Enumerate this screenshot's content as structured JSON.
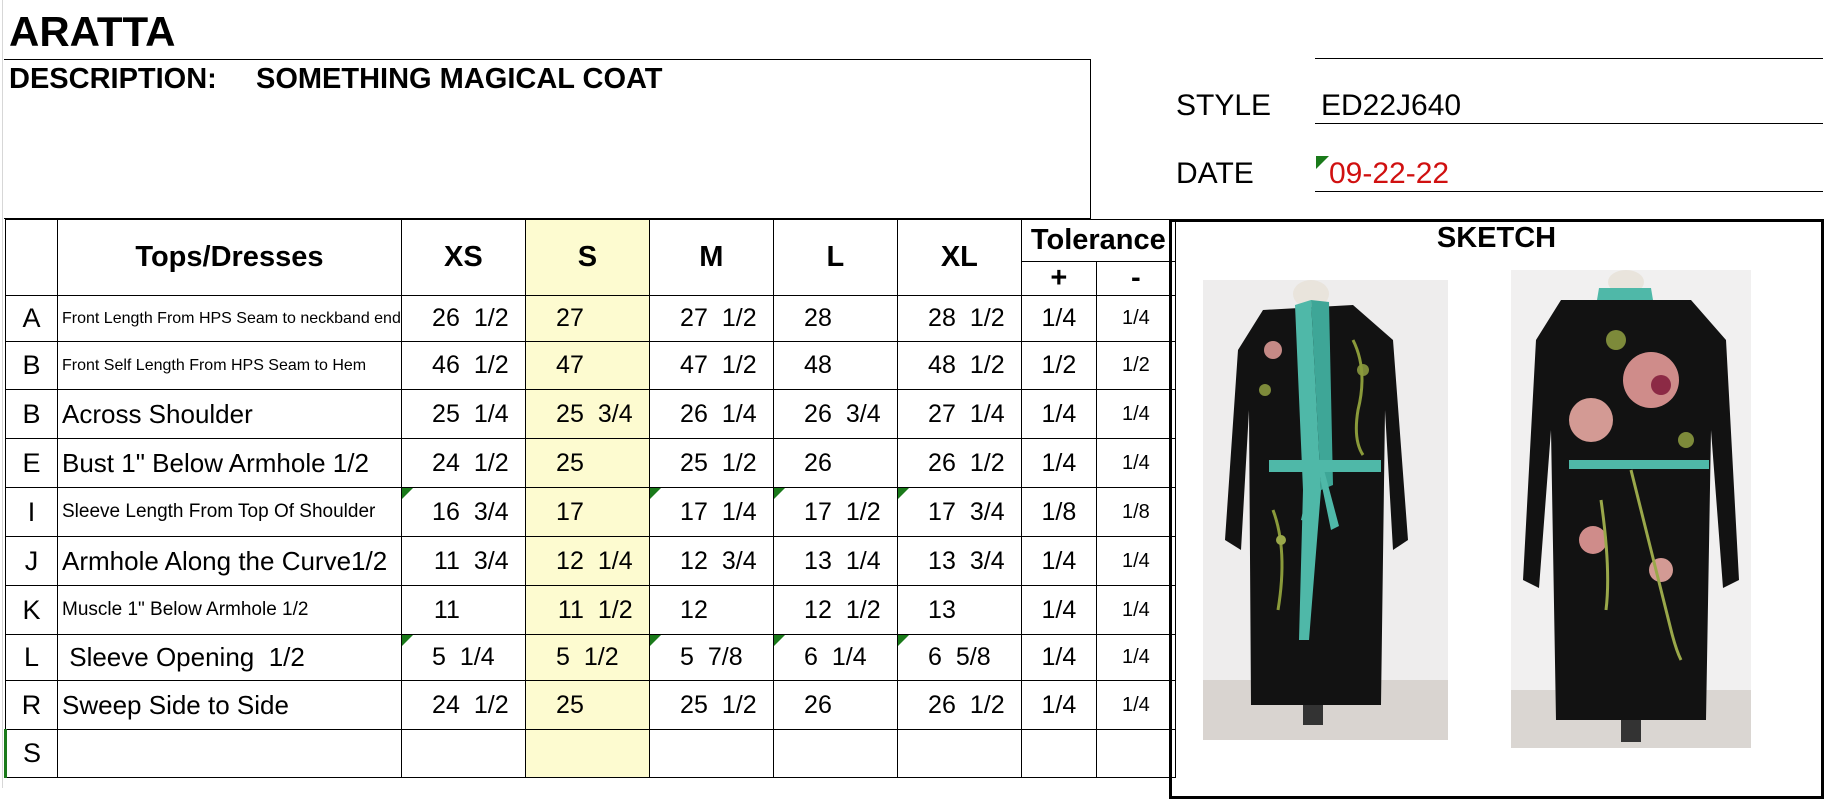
{
  "brand": "ARATTA",
  "description": {
    "label": "DESCRIPTION:",
    "value": "SOMETHING MAGICAL COAT"
  },
  "style": {
    "label": "STYLE",
    "value": "ED22J640"
  },
  "date": {
    "label": "DATE",
    "value": "09-22-22"
  },
  "table": {
    "header": {
      "item": "Tops/Dresses",
      "sizes": [
        "XS",
        "S",
        "M",
        "L",
        "XL"
      ],
      "tolerance": "Tolerance",
      "plus": "+",
      "minus": "-"
    },
    "rows": [
      {
        "letter": "A",
        "desc": "Front Length From HPS Seam to neckband end",
        "vals": [
          [
            "26",
            "1/2"
          ],
          [
            "27",
            ""
          ],
          [
            "27",
            "1/2"
          ],
          [
            "28",
            ""
          ],
          [
            "28",
            "1/2"
          ]
        ],
        "tol_plus": "1/4",
        "tol_minus": "1/4"
      },
      {
        "letter": "B",
        "desc": "Front Self Length From HPS Seam to Hem",
        "vals": [
          [
            "46",
            "1/2"
          ],
          [
            "47",
            ""
          ],
          [
            "47",
            "1/2"
          ],
          [
            "48",
            ""
          ],
          [
            "48",
            "1/2"
          ]
        ],
        "tol_plus": "1/2",
        "tol_minus": "1/2"
      },
      {
        "letter": "B",
        "desc": "Across Shoulder",
        "vals": [
          [
            "25",
            "1/4"
          ],
          [
            "25",
            "3/4"
          ],
          [
            "26",
            "1/4"
          ],
          [
            "26",
            "3/4"
          ],
          [
            "27",
            "1/4"
          ]
        ],
        "tol_plus": "1/4",
        "tol_minus": "1/4"
      },
      {
        "letter": "E",
        "desc": "Bust 1\" Below Armhole 1/2",
        "vals": [
          [
            "24",
            "1/2"
          ],
          [
            "25",
            ""
          ],
          [
            "25",
            "1/2"
          ],
          [
            "26",
            ""
          ],
          [
            "26",
            "1/2"
          ]
        ],
        "tol_plus": "1/4",
        "tol_minus": "1/4"
      },
      {
        "letter": "I",
        "desc": "Sleeve Length From Top Of Shoulder",
        "vals": [
          [
            "16",
            "3/4"
          ],
          [
            "17",
            ""
          ],
          [
            "17",
            "1/4"
          ],
          [
            "17",
            "1/2"
          ],
          [
            "17",
            "3/4"
          ]
        ],
        "tol_plus": "1/8",
        "tol_minus": "1/8"
      },
      {
        "letter": "J",
        "desc": "Armhole Along the Curve1/2",
        "vals": [
          [
            "11",
            "3/4"
          ],
          [
            "12",
            "1/4"
          ],
          [
            "12",
            "3/4"
          ],
          [
            "13",
            "1/4"
          ],
          [
            "13",
            "3/4"
          ]
        ],
        "tol_plus": "1/4",
        "tol_minus": "1/4"
      },
      {
        "letter": "K",
        "desc": "Muscle 1\" Below Armhole 1/2",
        "vals": [
          [
            "11",
            ""
          ],
          [
            "11",
            "1/2"
          ],
          [
            "12",
            ""
          ],
          [
            "12",
            "1/2"
          ],
          [
            "13",
            ""
          ]
        ],
        "tol_plus": "1/4",
        "tol_minus": "1/4"
      },
      {
        "letter": "L",
        "desc": " Sleeve Opening  1/2",
        "vals": [
          [
            "5",
            "1/4"
          ],
          [
            "5",
            "1/2"
          ],
          [
            "5",
            "7/8"
          ],
          [
            "6",
            "1/4"
          ],
          [
            "6",
            "5/8"
          ]
        ],
        "tol_plus": "1/4",
        "tol_minus": "1/4"
      },
      {
        "letter": "R",
        "desc": "Sweep Side to Side",
        "vals": [
          [
            "24",
            "1/2"
          ],
          [
            "25",
            ""
          ],
          [
            "25",
            "1/2"
          ],
          [
            "26",
            ""
          ],
          [
            "26",
            "1/2"
          ]
        ],
        "tol_plus": "1/4",
        "tol_minus": "1/4"
      },
      {
        "letter": "S",
        "desc": "",
        "vals": [
          [
            "",
            ""
          ],
          [
            "",
            ""
          ],
          [
            "",
            ""
          ],
          [
            "",
            ""
          ],
          [
            "",
            ""
          ]
        ],
        "tol_plus": "",
        "tol_minus": ""
      }
    ]
  },
  "sketch": {
    "title": "SKETCH",
    "photos": [
      "coat-front-photo",
      "coat-back-photo"
    ]
  },
  "colors": {
    "highlight": "#fdfbd0",
    "date_text": "#d01010",
    "comment_marker": "#1a7a1a",
    "coat": "#111111",
    "trim": "#4fb8a8"
  }
}
